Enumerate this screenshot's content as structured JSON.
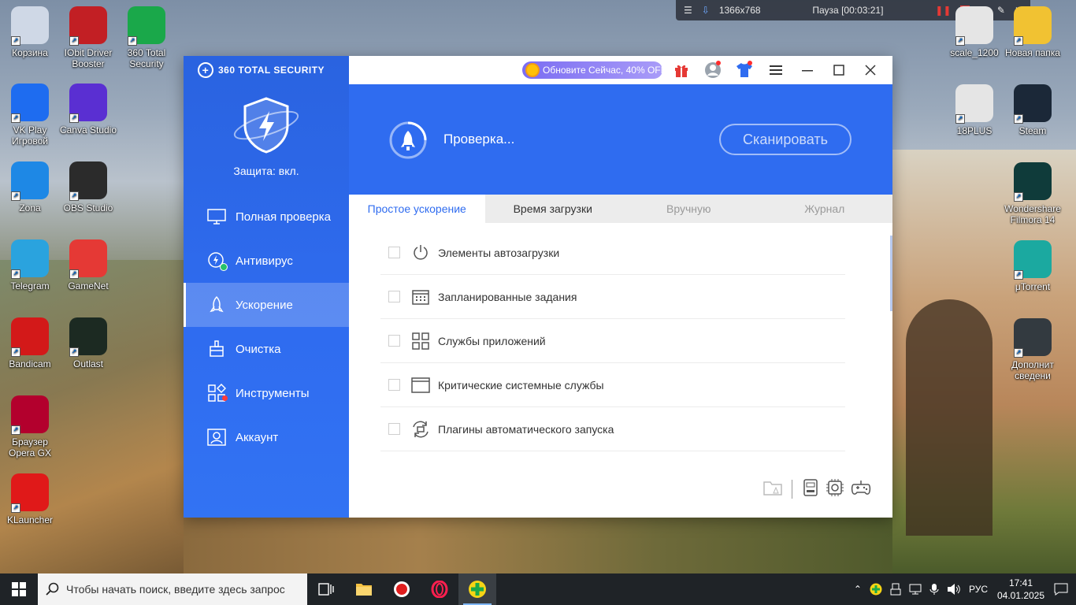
{
  "recorder": {
    "resolution": "1366x768",
    "status": "Пауза [00:03:21]"
  },
  "desktop_left": [
    {
      "label": "Корзина",
      "color": "#cfd8e6"
    },
    {
      "label": "IObit Driver Booster",
      "color": "#c21f24"
    },
    {
      "label": "360 Total Security",
      "color": "#1aa84a"
    },
    {
      "label": "VK Play Игровой",
      "color": "#1e6cf0"
    },
    {
      "label": "Canva Studio",
      "color": "#5a2fd2"
    },
    {
      "label": "Zona",
      "color": "#1e88e5"
    },
    {
      "label": "OBS Studio",
      "color": "#2b2b2b"
    },
    {
      "label": "Telegram",
      "color": "#2aa3de"
    },
    {
      "label": "GameNet",
      "color": "#e53935"
    },
    {
      "label": "Bandicam",
      "color": "#d31919"
    },
    {
      "label": "Outlast",
      "color": "#1c2a22"
    },
    {
      "label": "Браузер Opera GX",
      "color": "#b3002d"
    },
    {
      "label": "KLauncher",
      "color": "#e01919"
    }
  ],
  "desktop_right": [
    {
      "label": "scale_1200",
      "color": "#e5e5e5"
    },
    {
      "label": "Новая папка",
      "color": "#f1c232"
    },
    {
      "label": "18PLUS",
      "color": "#e5e5e5"
    },
    {
      "label": "Steam",
      "color": "#1b2838"
    },
    {
      "label": "Wondershare Filmora 14",
      "color": "#0f3b3a"
    },
    {
      "label": "μTorrent",
      "color": "#1ba9a0"
    },
    {
      "label": "Дополнит сведени",
      "color": "#333a40"
    }
  ],
  "app": {
    "brand": "360 TOTAL SECURITY",
    "promo": "Обновите Сейчас, 40% OFF",
    "protection": "Защита: вкл.",
    "nav": [
      {
        "label": "Полная проверка",
        "icon": "monitor-icon"
      },
      {
        "label": "Антивирус",
        "icon": "antivirus-icon"
      },
      {
        "label": "Ускорение",
        "icon": "rocket-icon"
      },
      {
        "label": "Очистка",
        "icon": "broom-icon"
      },
      {
        "label": "Инструменты",
        "icon": "tools-icon"
      },
      {
        "label": "Аккаунт",
        "icon": "account-icon"
      }
    ],
    "active_nav": "Ускорение",
    "hero_status": "Проверка...",
    "scan_button": "Сканировать",
    "tabs": [
      "Простое ускорение",
      "Время загрузки",
      "Вручную",
      "Журнал"
    ],
    "active_tab": "Простое ускорение",
    "items": [
      {
        "label": "Элементы автозагрузки",
        "icon": "power-icon"
      },
      {
        "label": "Запланированные задания",
        "icon": "calendar-icon"
      },
      {
        "label": "Службы приложений",
        "icon": "grid-icon"
      },
      {
        "label": "Критические системные службы",
        "icon": "window-icon"
      },
      {
        "label": "Плагины автоматического запуска",
        "icon": "plugin-icon"
      }
    ],
    "accent": "#2f6cf0"
  },
  "taskbar": {
    "search_placeholder": "Чтобы начать поиск, введите здесь запрос",
    "language": "РУС",
    "time": "17:41",
    "date": "04.01.2025"
  }
}
